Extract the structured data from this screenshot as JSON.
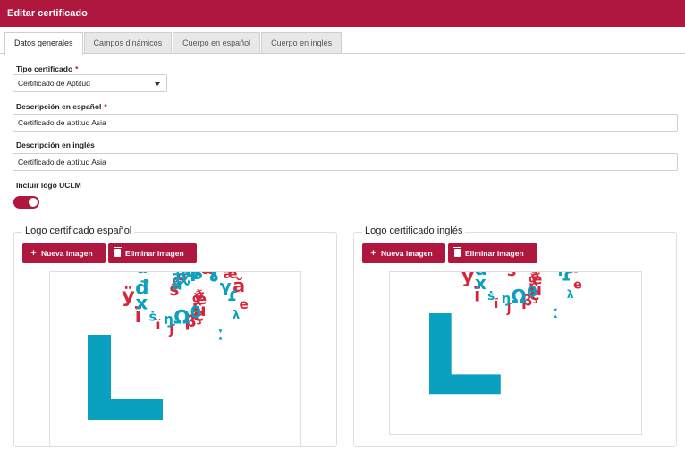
{
  "header": {
    "title": "Editar certificado"
  },
  "tabs": [
    {
      "label": "Datos generales",
      "active": true
    },
    {
      "label": "Campos dinámicos",
      "active": false
    },
    {
      "label": "Cuerpo en español",
      "active": false
    },
    {
      "label": "Cuerpo en inglés",
      "active": false
    }
  ],
  "form": {
    "tipo": {
      "label": "Tipo certificado",
      "required": "*",
      "value": "Certificado de Aptitud"
    },
    "desc_es": {
      "label": "Descripción en español",
      "required": "*",
      "value": "Certificado de aptitud Asia"
    },
    "desc_en": {
      "label": "Descripción en inglés",
      "value": "Certificado de aptitud Asia"
    },
    "logo_uclm": {
      "label": "Incluir logo UCLM",
      "on": true
    }
  },
  "logo_es": {
    "title": "Logo certificado español",
    "new_label": "Nueva imagen",
    "delete_label": "Eliminar imagen"
  },
  "logo_en": {
    "title": "Logo certificado inglés",
    "new_label": "Nueva imagen",
    "delete_label": "Eliminar imagen"
  },
  "logo_glyphs": {
    "red": [
      "ð",
      "ë",
      "ù",
      "ç",
      "β",
      "ʃ",
      "ĭ",
      "ï",
      "ÿ",
      "ŝ",
      "ñ",
      "ö",
      "ż",
      "Σ",
      "œ",
      "æ",
      "ă",
      "e",
      "ǧ",
      "ɩ"
    ],
    "blue": [
      "θ",
      "Ω",
      "ŋ",
      "ṡ",
      "x",
      "đ",
      "ä",
      "ü",
      "我",
      "ɸ",
      "ʒ",
      "ɣ",
      "γ",
      "ɾ",
      "λ",
      "ː"
    ]
  },
  "colors": {
    "accent": "#b0173e",
    "logo_blue": "#0aa0c0",
    "logo_red": "#d6263b"
  }
}
